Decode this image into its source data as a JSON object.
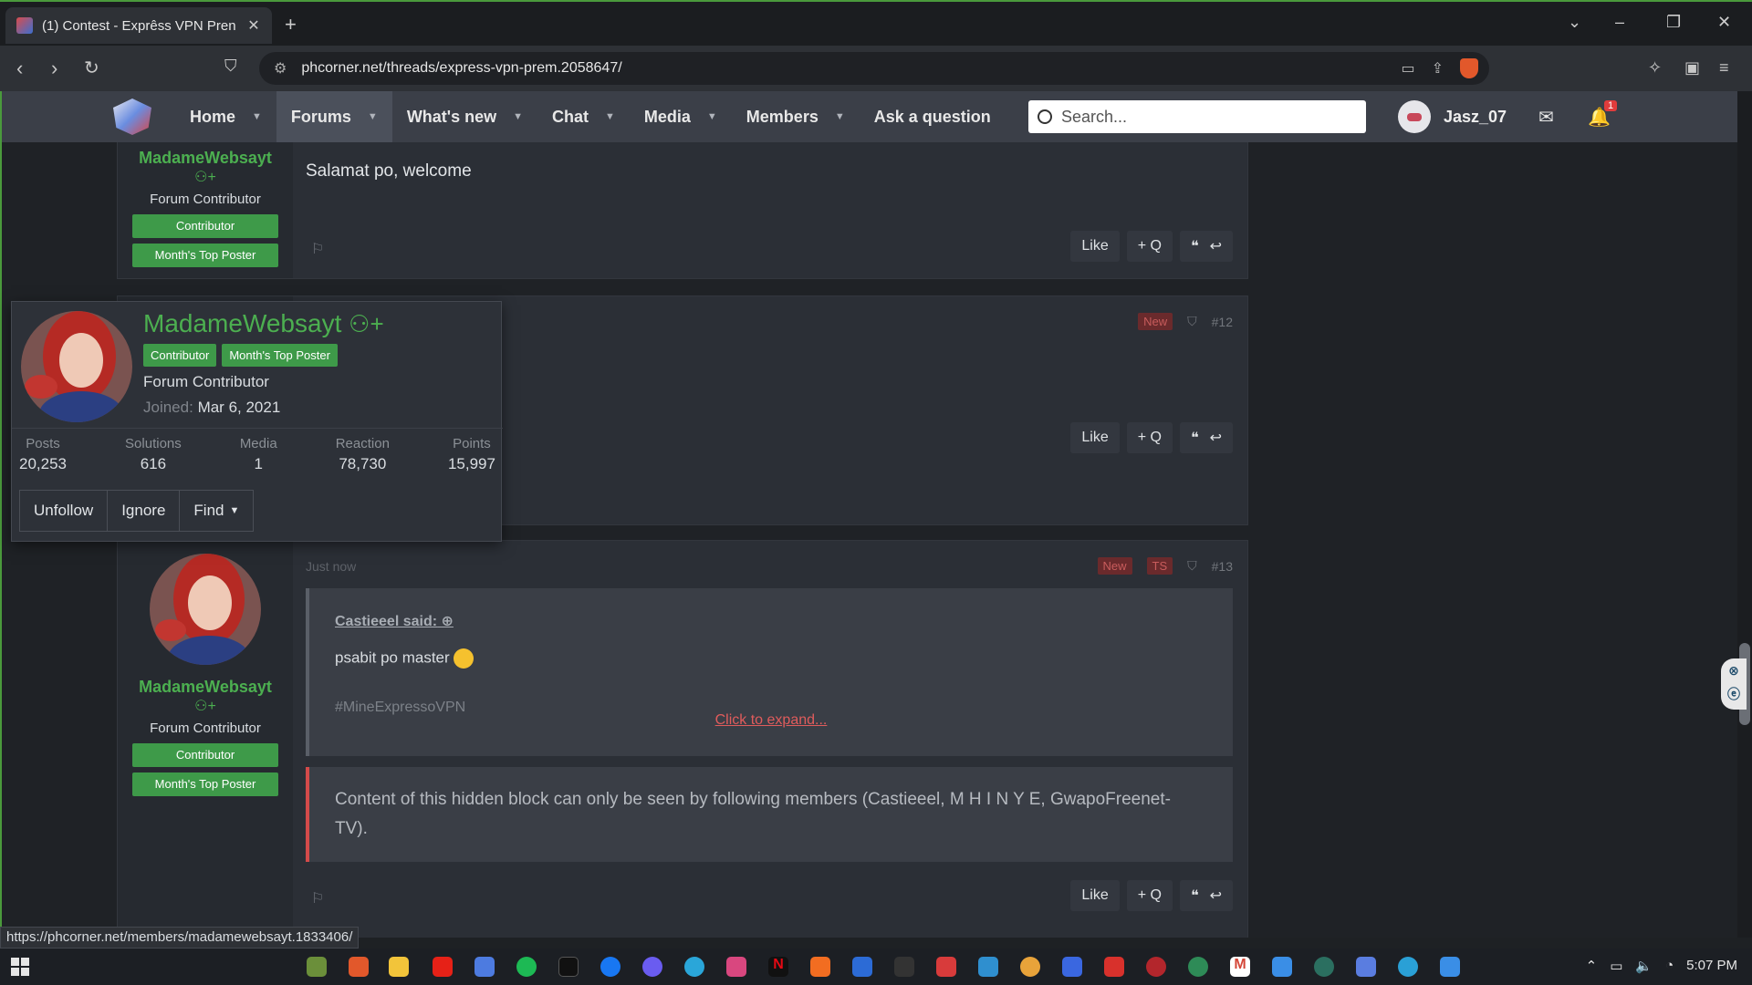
{
  "browser": {
    "tab_title": "(1) Contest - Exprêss VPN Pren",
    "tab_close": "✕",
    "new_tab": "+",
    "url": "phcorner.net/threads/express-vpn-prem.2058647/",
    "status_url": "https://phcorner.net/members/madamewebsayt.1833406/"
  },
  "site": {
    "nav": [
      {
        "label": "Home",
        "caret": "▼"
      },
      {
        "label": "Forums",
        "caret": "▼"
      },
      {
        "label": "What's new",
        "caret": "▼"
      },
      {
        "label": "Chat",
        "caret": "▼"
      },
      {
        "label": "Media",
        "caret": "▼"
      },
      {
        "label": "Members",
        "caret": "▼"
      },
      {
        "label": "Ask a question",
        "caret": ""
      }
    ],
    "search_placeholder": "Search...",
    "username": "Jasz_07",
    "notif_count": "1"
  },
  "posts": {
    "p1": {
      "author": "MadameWebsayt",
      "role": "Forum Contributor",
      "banners": [
        "Contributor",
        "Month's Top Poster"
      ],
      "message": "Salamat po, welcome"
    },
    "p2": {
      "new": "New",
      "number": "#12"
    },
    "p3": {
      "time": "Just now",
      "new": "New",
      "ts": "TS",
      "number": "#13",
      "author": "MadameWebsayt",
      "role": "Forum Contributor",
      "banners": [
        "Contributor",
        "Month's Top Poster"
      ],
      "quote_author": "Castieeel said:",
      "quote_line1": "psabit po master",
      "quote_line2": "#MineExpressoVPN",
      "expand": "Click to expand...",
      "hidden_text": "Content of this hidden block can only be seen by following members (Castieeel, M H I N Y E, GwapoFreenet-TV)."
    }
  },
  "actions": {
    "like": "Like",
    "multiquote": "+ Q",
    "quote": "❝",
    "reply": "↩"
  },
  "card": {
    "name": "MadameWebsayt",
    "badges": [
      "Contributor",
      "Month's Top Poster"
    ],
    "role": "Forum Contributor",
    "joined_label": "Joined:",
    "joined_value": "Mar 6, 2021",
    "stats": [
      {
        "label": "Posts",
        "value": "20,253"
      },
      {
        "label": "Solutions",
        "value": "616"
      },
      {
        "label": "Media",
        "value": "1"
      },
      {
        "label": "Reaction",
        "value": "78,730"
      },
      {
        "label": "Points",
        "value": "15,997"
      }
    ],
    "buttons": {
      "unfollow": "Unfollow",
      "ignore": "Ignore",
      "find": "Find"
    }
  },
  "taskbar": {
    "time": "5:07 PM"
  },
  "colors": {
    "accent_green": "#4caf50",
    "banner_green": "#3e9a49",
    "header_bg": "#3b3f48",
    "hidden_border": "#d44a4a"
  }
}
